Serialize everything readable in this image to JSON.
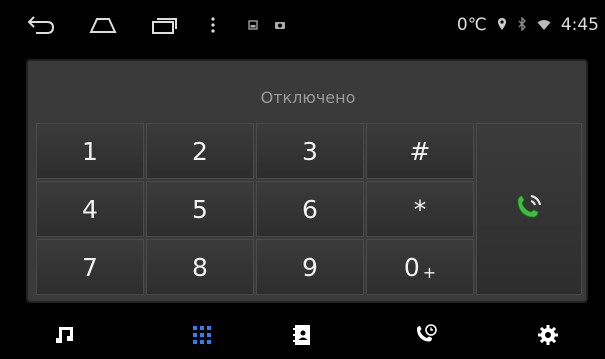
{
  "status_bar": {
    "icons": [
      "back-icon",
      "home-icon",
      "recent-apps-icon",
      "overflow-menu-icon",
      "notification-icon",
      "camera-notification-icon",
      "location-icon",
      "bluetooth-icon",
      "wifi-icon"
    ],
    "temperature": "0℃",
    "time": "4:45"
  },
  "dialer": {
    "status_text": "Отключено",
    "keys": [
      {
        "label": "1",
        "sub": ""
      },
      {
        "label": "2",
        "sub": ""
      },
      {
        "label": "3",
        "sub": ""
      },
      {
        "label": "#",
        "sub": ""
      },
      {
        "label": "4",
        "sub": ""
      },
      {
        "label": "5",
        "sub": ""
      },
      {
        "label": "6",
        "sub": ""
      },
      {
        "label": "*",
        "sub": ""
      },
      {
        "label": "7",
        "sub": ""
      },
      {
        "label": "8",
        "sub": ""
      },
      {
        "label": "9",
        "sub": ""
      },
      {
        "label": "0",
        "sub": "+"
      }
    ],
    "call_icon": "call-phone-icon"
  },
  "bottom_nav": {
    "items": [
      {
        "icon": "music-icon",
        "active": false
      },
      {
        "icon": "dialpad-icon",
        "active": true
      },
      {
        "icon": "contacts-icon",
        "active": false
      },
      {
        "icon": "call-history-icon",
        "active": false
      },
      {
        "icon": "settings-icon",
        "active": false
      }
    ],
    "active_color": "#2d7ff9"
  },
  "colors": {
    "call_green": "#3fbf3f",
    "background": "#000000",
    "panel": "#3a3a3a"
  }
}
